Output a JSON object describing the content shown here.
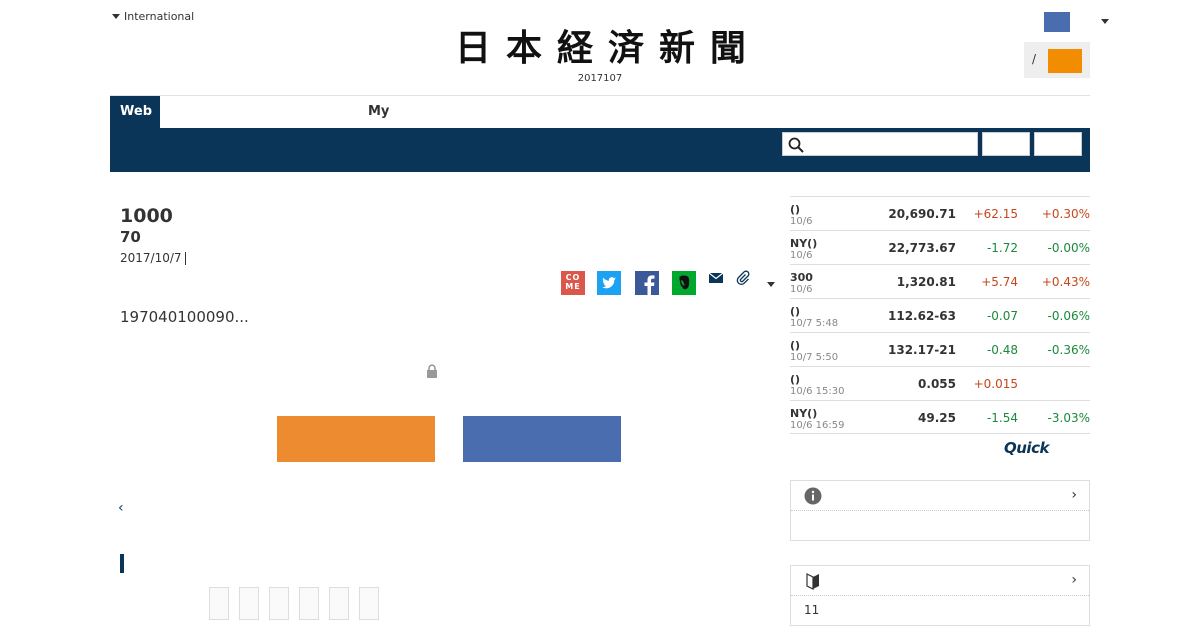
{
  "header": {
    "edition_label": "International",
    "logo_chars": [
      "日",
      "本",
      "経",
      "済",
      "新",
      "聞"
    ],
    "issue_date": "2017107",
    "login_separator": "/"
  },
  "nav": {
    "tab_web": "Web",
    "tab_my": "My",
    "search_placeholder": ""
  },
  "article": {
    "headline_line1": "1000",
    "headline_line2": "70",
    "date": "2017/10/7",
    "lead": "197040100090..."
  },
  "share": {
    "come_label_top": "CO",
    "come_label_bottom": "ME"
  },
  "market": {
    "rows": [
      {
        "name": "()",
        "time": "10/6",
        "value": "20,690.71",
        "change": "+62.15",
        "pct": "+0.30%"
      },
      {
        "name": "NY()",
        "time": "10/6",
        "value": "22,773.67",
        "change": "-1.72",
        "pct": "-0.00%"
      },
      {
        "name": "300",
        "time": "10/6",
        "value": "1,320.81",
        "change": "+5.74",
        "pct": "+0.43%"
      },
      {
        "name": "()",
        "time": "10/7 5:48",
        "value": "112.62-63",
        "change": "-0.07",
        "pct": "-0.06%"
      },
      {
        "name": "()",
        "time": "10/7 5:50",
        "value": "132.17-21",
        "change": "-0.48",
        "pct": "-0.36%"
      },
      {
        "name": "()",
        "time": "10/6 15:30",
        "value": "0.055",
        "change": "+0.015",
        "pct": ""
      },
      {
        "name": "NY()",
        "time": "10/6 16:59",
        "value": "49.25",
        "change": "-1.54",
        "pct": "-3.03%"
      }
    ],
    "provider": "Quick",
    "colors": {
      "up": "#c8461a",
      "down": "#1a8a3a"
    }
  },
  "widgets": {
    "w1_body": "",
    "w2_body": "11"
  }
}
